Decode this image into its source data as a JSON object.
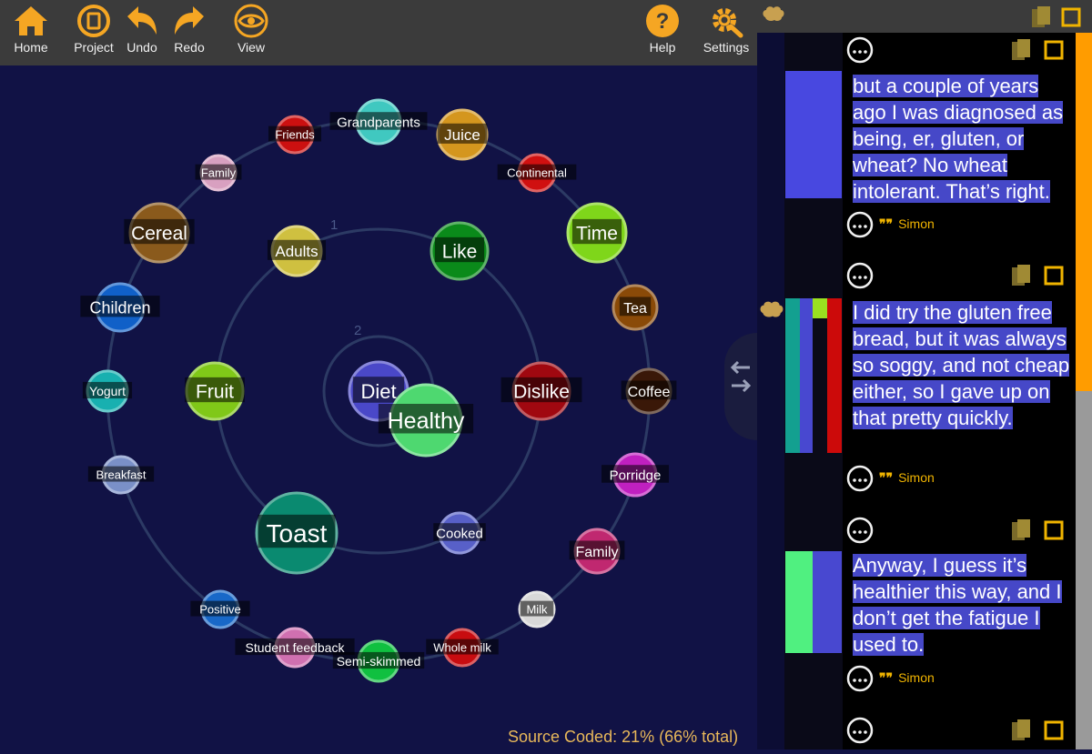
{
  "toolbar": {
    "home_label": "Home",
    "project_label": "Project",
    "undo_label": "Undo",
    "redo_label": "Redo",
    "view_label": "View",
    "help_label": "Help",
    "settings_label": "Settings"
  },
  "diagram": {
    "ring_labels": [
      "1",
      "2"
    ],
    "nodes": [
      {
        "label": "Grandparents",
        "color": "#40c8c0"
      },
      {
        "label": "Juice",
        "color": "#d4961e"
      },
      {
        "label": "Friends",
        "color": "#cc1010"
      },
      {
        "label": "Continental",
        "color": "#d01010"
      },
      {
        "label": "Family",
        "color": "#d8a0c0"
      },
      {
        "label": "Time",
        "color": "#7fd61a"
      },
      {
        "label": "Cereal",
        "color": "#8a5a1c"
      },
      {
        "label": "Adults",
        "color": "#cfc040"
      },
      {
        "label": "Like",
        "color": "#0a8a1a"
      },
      {
        "label": "Tea",
        "color": "#8a4a08"
      },
      {
        "label": "Children",
        "color": "#1060c8"
      },
      {
        "label": "Yogurt",
        "color": "#18b0b0"
      },
      {
        "label": "Fruit",
        "color": "#80c818"
      },
      {
        "label": "Diet",
        "color": "#4a48c8"
      },
      {
        "label": "Healthy",
        "color": "#4ed870"
      },
      {
        "label": "Dislike",
        "color": "#a00810"
      },
      {
        "label": "Coffee",
        "color": "#3a1808"
      },
      {
        "label": "Breakfast",
        "color": "#7a90c8"
      },
      {
        "label": "Porridge",
        "color": "#c020c0"
      },
      {
        "label": "Toast",
        "color": "#0a8a70"
      },
      {
        "label": "Cooked",
        "color": "#5860c8"
      },
      {
        "label": "Family",
        "color": "#c02870"
      },
      {
        "label": "Milk",
        "color": "#d8d8d8"
      },
      {
        "label": "Positive",
        "color": "#1868c8"
      },
      {
        "label": "Student feedback",
        "color": "#d070b0"
      },
      {
        "label": "Semi-skimmed",
        "color": "#10c040"
      },
      {
        "label": "Whole milk",
        "color": "#c80c10"
      }
    ]
  },
  "status": {
    "source_coded": "Source Coded: 21% (66% total)"
  },
  "transcript": {
    "passages": [
      {
        "text": "but a couple of years ago I was diagnosed as being, er, gluten, or wheat? No wheat intolerant. That’s right.",
        "speaker": "Simon"
      },
      {
        "text": " I did try the gluten free bread, but it was always so soggy, and not cheap either, so I gave up on that pretty quickly.",
        "speaker": "Simon"
      },
      {
        "text": "Anyway, I guess it’s healthier this way, and I don’t get the fatigue I used to.",
        "speaker": "Simon"
      }
    ]
  },
  "colors": {
    "accent": "#f0b400",
    "scroll_thumb": "#ff9c00",
    "highlight": "#4648c8"
  }
}
